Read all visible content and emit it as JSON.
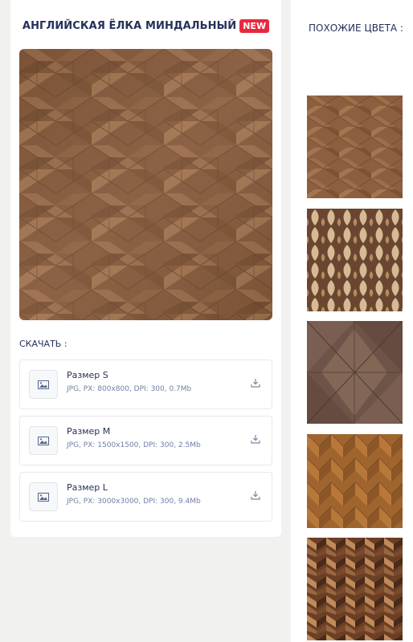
{
  "product": {
    "title": "АНГЛИЙСКАЯ ЁЛКА МИНДАЛЬНЫЙ",
    "badge": "NEW"
  },
  "downloads": {
    "label": "СКАЧАТЬ :",
    "items": [
      {
        "name": "Размер S",
        "meta": "JPG, PX: 800x800, DPI: 300, 0.7Mb"
      },
      {
        "name": "Размер M",
        "meta": "JPG, PX: 1500x1500, DPI: 300, 2.5Mb"
      },
      {
        "name": "Размер L",
        "meta": "JPG, PX: 3000x3000, DPI: 300, 9.4Mb"
      }
    ]
  },
  "similar": {
    "title": "ПОХОЖИЕ ЦВЕТА :"
  },
  "colors": {
    "title_text": "#26305a",
    "badge_bg": "#e8293d",
    "meta_text": "#6f7fa3",
    "wood_main": "#8a5e40"
  },
  "icons": {
    "thumb": "image-icon",
    "download": "download-icon"
  }
}
